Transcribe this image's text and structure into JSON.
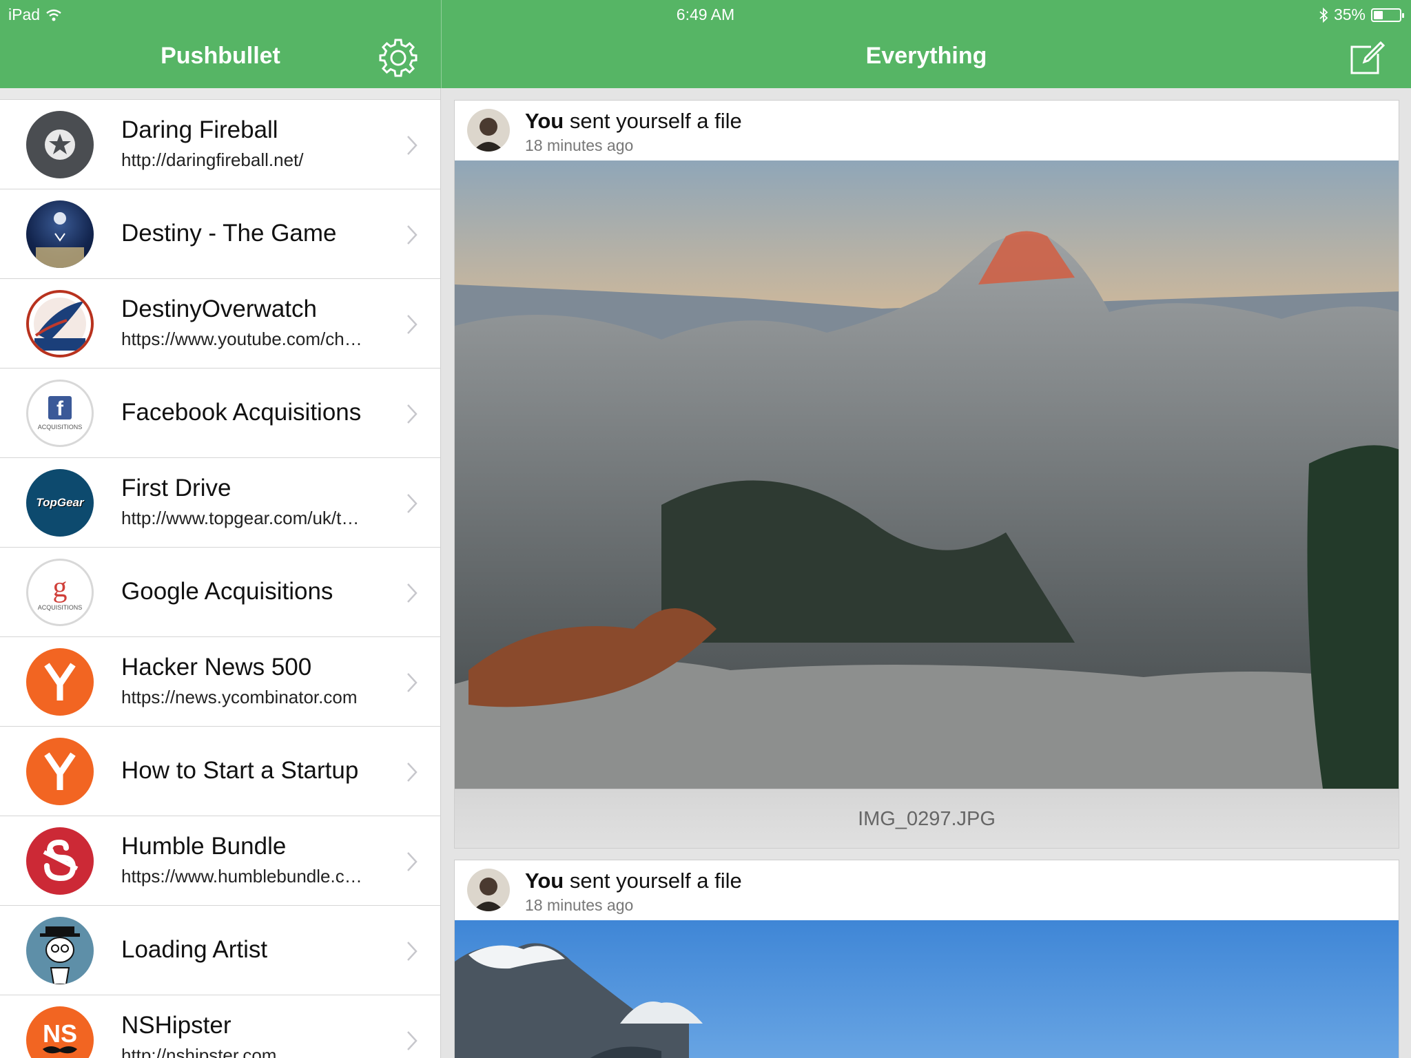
{
  "status_bar": {
    "device": "iPad",
    "time": "6:49 AM",
    "battery": "35%",
    "battery_level": 0.35
  },
  "sidebar": {
    "title": "Pushbullet",
    "items": [
      {
        "title": "Daring Fireball",
        "url": "http://daringfireball.net/",
        "icon": "star-icon"
      },
      {
        "title": "Destiny - The Game",
        "url": "",
        "icon": "destiny-logo-icon"
      },
      {
        "title": "DestinyOverwatch",
        "url": "https://www.youtube.com/ch…",
        "icon": "destiny-overwatch-icon"
      },
      {
        "title": "Facebook Acquisitions",
        "url": "",
        "icon": "facebook-acquisitions-icon",
        "badge": "ACQUISITIONS"
      },
      {
        "title": "First Drive",
        "url": "http://www.topgear.com/uk/t…",
        "icon": "topgear-icon",
        "badge": "TopGear"
      },
      {
        "title": "Google Acquisitions",
        "url": "",
        "icon": "google-acquisitions-icon",
        "badge": "ACQUISITIONS"
      },
      {
        "title": "Hacker News 500",
        "url": "https://news.ycombinator.com",
        "icon": "ycombinator-icon"
      },
      {
        "title": "How to Start a Startup",
        "url": "",
        "icon": "ycombinator-icon"
      },
      {
        "title": "Humble Bundle",
        "url": "https://www.humblebundle.c…",
        "icon": "humble-bundle-icon"
      },
      {
        "title": "Loading Artist",
        "url": "",
        "icon": "loading-artist-icon"
      },
      {
        "title": "NSHipster",
        "url": "http://nshipster.com",
        "icon": "nshipster-icon"
      }
    ]
  },
  "feed": {
    "title": "Everything",
    "cards": [
      {
        "sender": "You",
        "action": "sent yourself a file",
        "time_ago": "18 minutes ago",
        "file_name": "IMG_0297.JPG"
      },
      {
        "sender": "You",
        "action": "sent yourself a file",
        "time_ago": "18 minutes ago",
        "file_name": ""
      }
    ]
  },
  "colors": {
    "header_green": "#56b565",
    "yc_orange": "#f26522",
    "humble_red": "#cc2936",
    "topgear_blue": "#0d4a6e"
  }
}
